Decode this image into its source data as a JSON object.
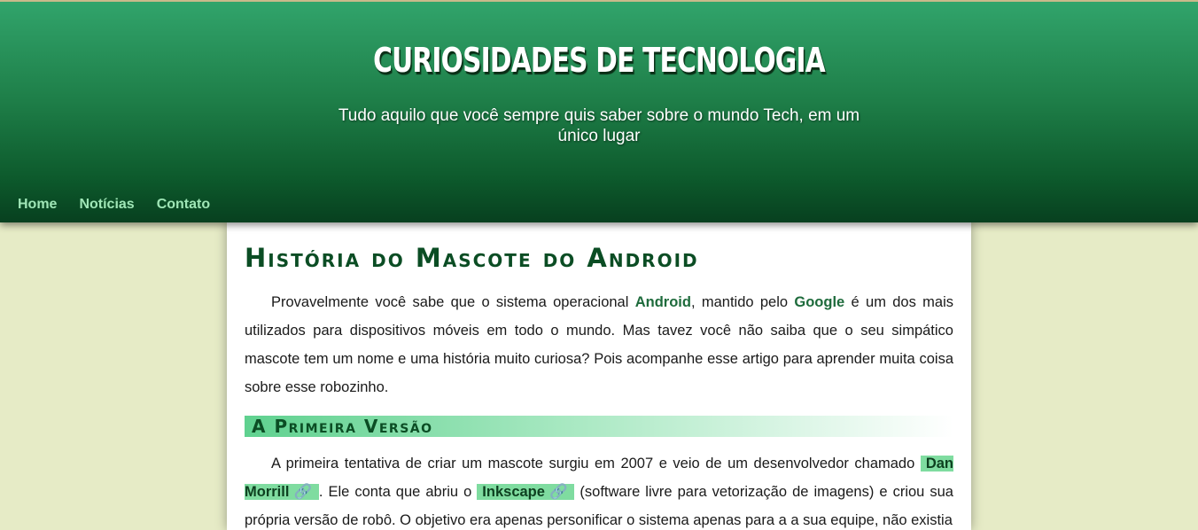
{
  "header": {
    "title": "CURIOSIDADES DE TECNOLOGIA",
    "subtitle": "Tudo aquilo que você sempre quis saber sobre o mundo Tech, em um único lugar"
  },
  "nav": {
    "items": [
      {
        "label": "Home"
      },
      {
        "label": "Notícias"
      },
      {
        "label": "Contato"
      }
    ]
  },
  "article": {
    "title": "História do Mascote do Android",
    "intro": {
      "part1": "Provavelmente você sabe que o sistema operacional ",
      "kw_android": "Android",
      "part2": ", mantido pelo ",
      "kw_google": "Google",
      "part3": " é um dos mais utilizados para dispositivos móveis em todo o mundo. Mas tavez você não saiba que o seu simpático mascote tem um nome e uma história muito curiosa? Pois acompanhe esse artigo para aprender muita coisa sobre esse robozinho."
    },
    "section1": {
      "heading": "A Primeira Versão",
      "part1": "A primeira tentativa de criar um mascote surgiu em 2007 e veio de um desenvolvedor chamado ",
      "link_dan": "Dan Morrill",
      "part2": ". Ele conta que abriu o ",
      "link_inkscape": "Inkscape",
      "part3": " (software livre para vetorização de imagens) e criou sua própria versão de robô. O objetivo era apenas personificar o sistema apenas para a a sua equipe, não existia"
    },
    "link_icon": "🔗"
  },
  "colors": {
    "header_top": "#31a46b",
    "header_bottom": "#07401f",
    "nav_link": "#9fe6b6",
    "page_bg": "#e6ebc6",
    "heading": "#0b4d24",
    "link_highlight": "#7fdca0"
  },
  "icons": {
    "link": "link-icon"
  }
}
